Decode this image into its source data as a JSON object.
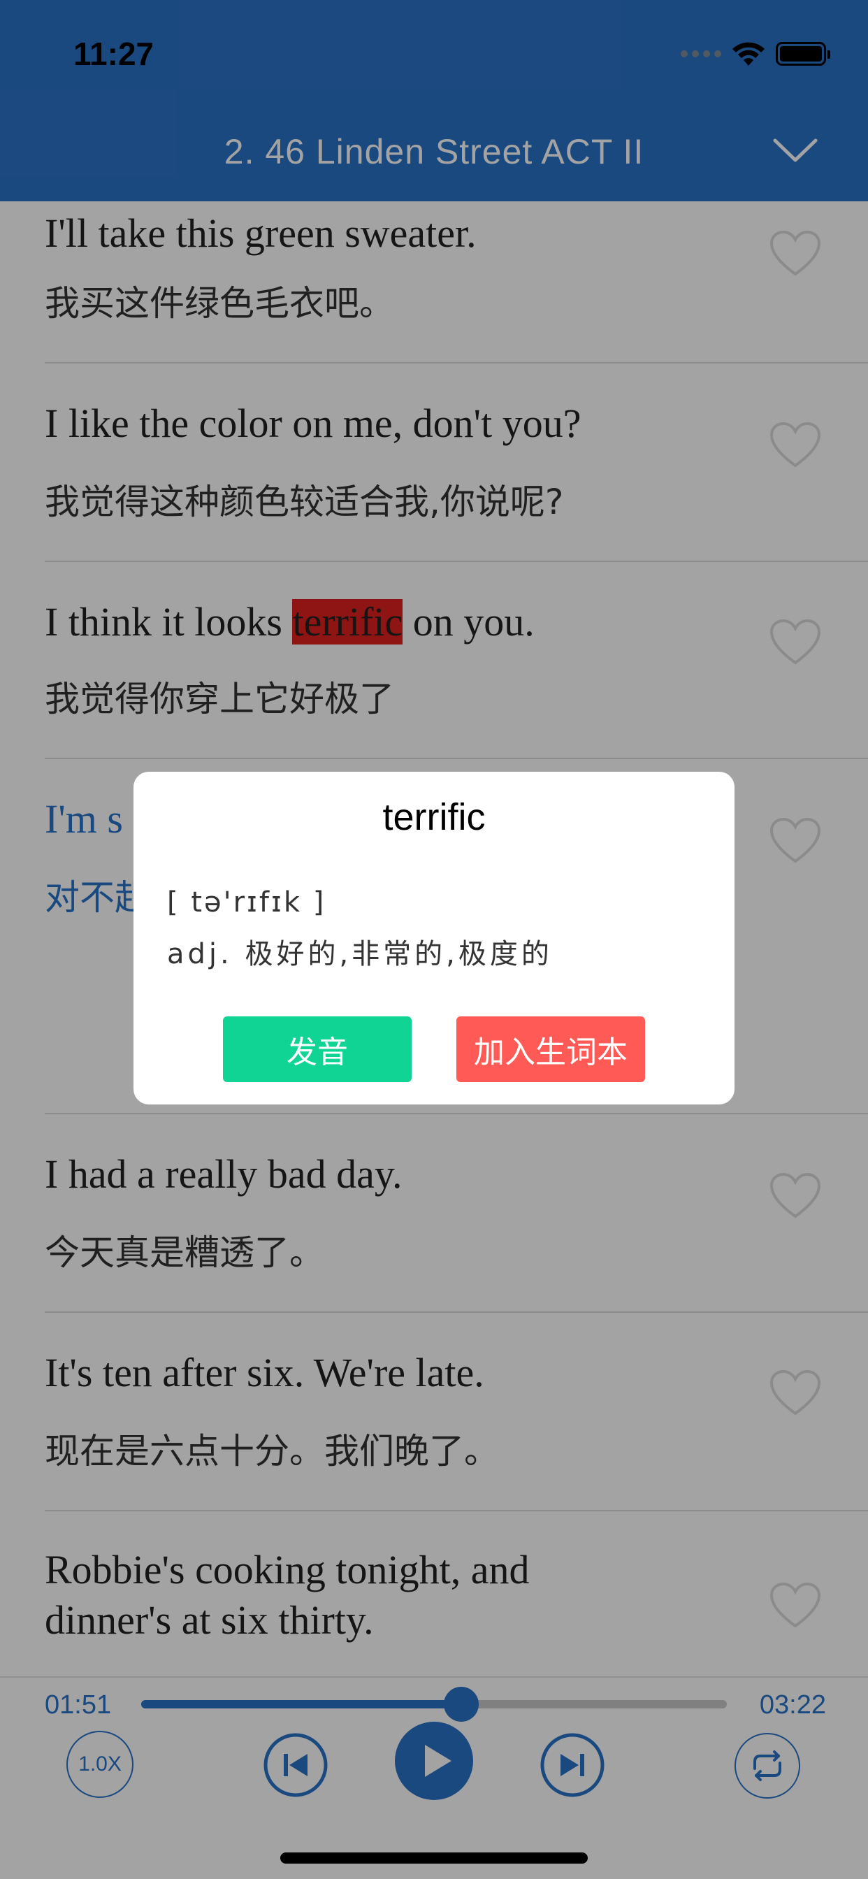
{
  "status_bar": {
    "time": "11:27"
  },
  "nav": {
    "title": "2. 46 Linden Street ACT II"
  },
  "sentences": [
    {
      "en": "I'll take this green sweater.",
      "zh": "我买这件绿色毛衣吧。"
    },
    {
      "en": "I like the color on me, don't you?",
      "zh": "我觉得这种颜色较适合我,你说呢?"
    },
    {
      "en_before": "I think it looks ",
      "en_highlight": "terrific",
      "en_after": " on you.",
      "zh": "我觉得你穿上它好极了"
    },
    {
      "en": "I'm s",
      "zh": "对不起",
      "active": true
    },
    {
      "en": "I had a really bad day.",
      "zh": "今天真是糟透了。"
    },
    {
      "en": "It's ten after six. We're late.",
      "zh": "现在是六点十分。我们晚了。"
    },
    {
      "en_line1": "Robbie's cooking tonight, and",
      "en_line2": "dinner's at six thirty."
    }
  ],
  "player": {
    "current_time": "01:51",
    "total_time": "03:22",
    "progress": 0.547,
    "speed_label": "1.0X"
  },
  "dialog": {
    "word": "terrific",
    "phonetic": "[ tə'rɪfɪk ]",
    "definition": "adj. 极好的,非常的,极度的",
    "pronounce_label": "发音",
    "add_label": "加入生词本"
  },
  "colors": {
    "accent": "#2a72c8",
    "pronounce_button": "#10d494",
    "add_button": "#ff5a55",
    "highlight": "#e02020"
  }
}
